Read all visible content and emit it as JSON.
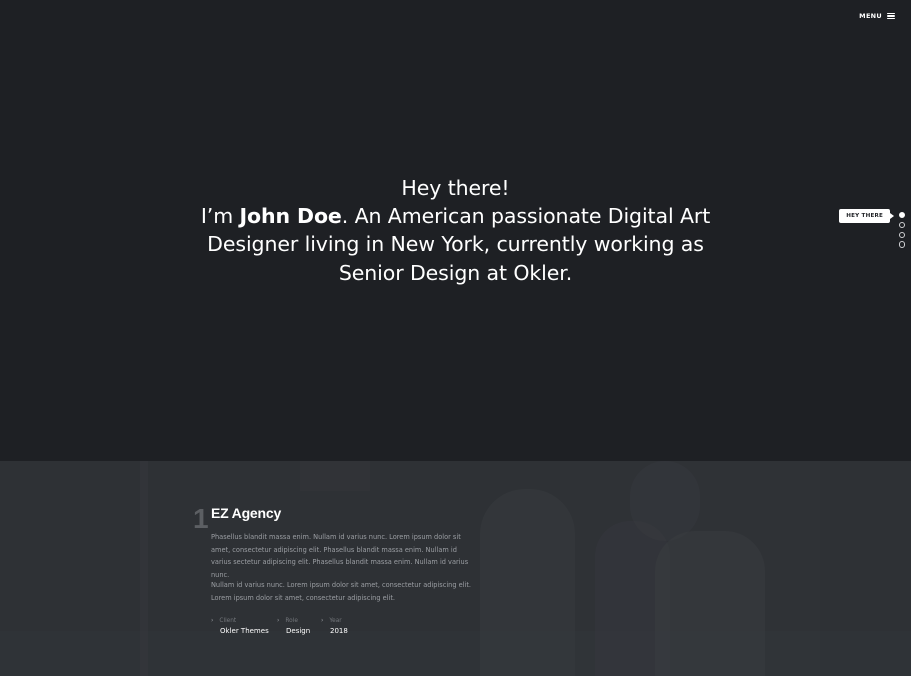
{
  "header": {
    "menu_label": "MENU",
    "menu_icon": "hamburger-icon"
  },
  "hero": {
    "line1": "Hey there!",
    "intro_prefix": "I’m ",
    "name": "John Doe",
    "intro_rest": ". An American passionate Digital Art Designer living in New York, currently working as Senior Design at Okler."
  },
  "section_nav": {
    "tooltip": "HEY THERE",
    "dots": [
      {
        "name": "section-dot-1",
        "active": true
      },
      {
        "name": "section-dot-2",
        "active": false
      },
      {
        "name": "section-dot-3",
        "active": false
      },
      {
        "name": "section-dot-4",
        "active": false
      }
    ]
  },
  "work": {
    "number": "1",
    "title": "EZ Agency",
    "paragraph1": "Phasellus blandit massa enim. Nullam id varius nunc. Lorem ipsum dolor sit amet, consectetur adipiscing elit. Phasellus blandit massa enim. Nullam id varius sectetur adipiscing elit. Phasellus blandit massa enim. Nullam id varius nunc.",
    "paragraph2": "Nullam id varius nunc. Lorem ipsum dolor sit amet, consectetur adipiscing elit. Lorem ipsum dolor sit amet, consectetur adipiscing elit.",
    "meta": [
      {
        "label": "Client",
        "value": "Okler Themes"
      },
      {
        "label": "Role",
        "value": "Design"
      },
      {
        "label": "Year",
        "value": "2018"
      }
    ],
    "chevron_icon": "chevron-right-icon"
  },
  "colors": {
    "hero_bg": "#1e2024",
    "work_bg": "#2e3135",
    "text_primary": "#ffffff",
    "text_muted": "#9b9ea3"
  }
}
